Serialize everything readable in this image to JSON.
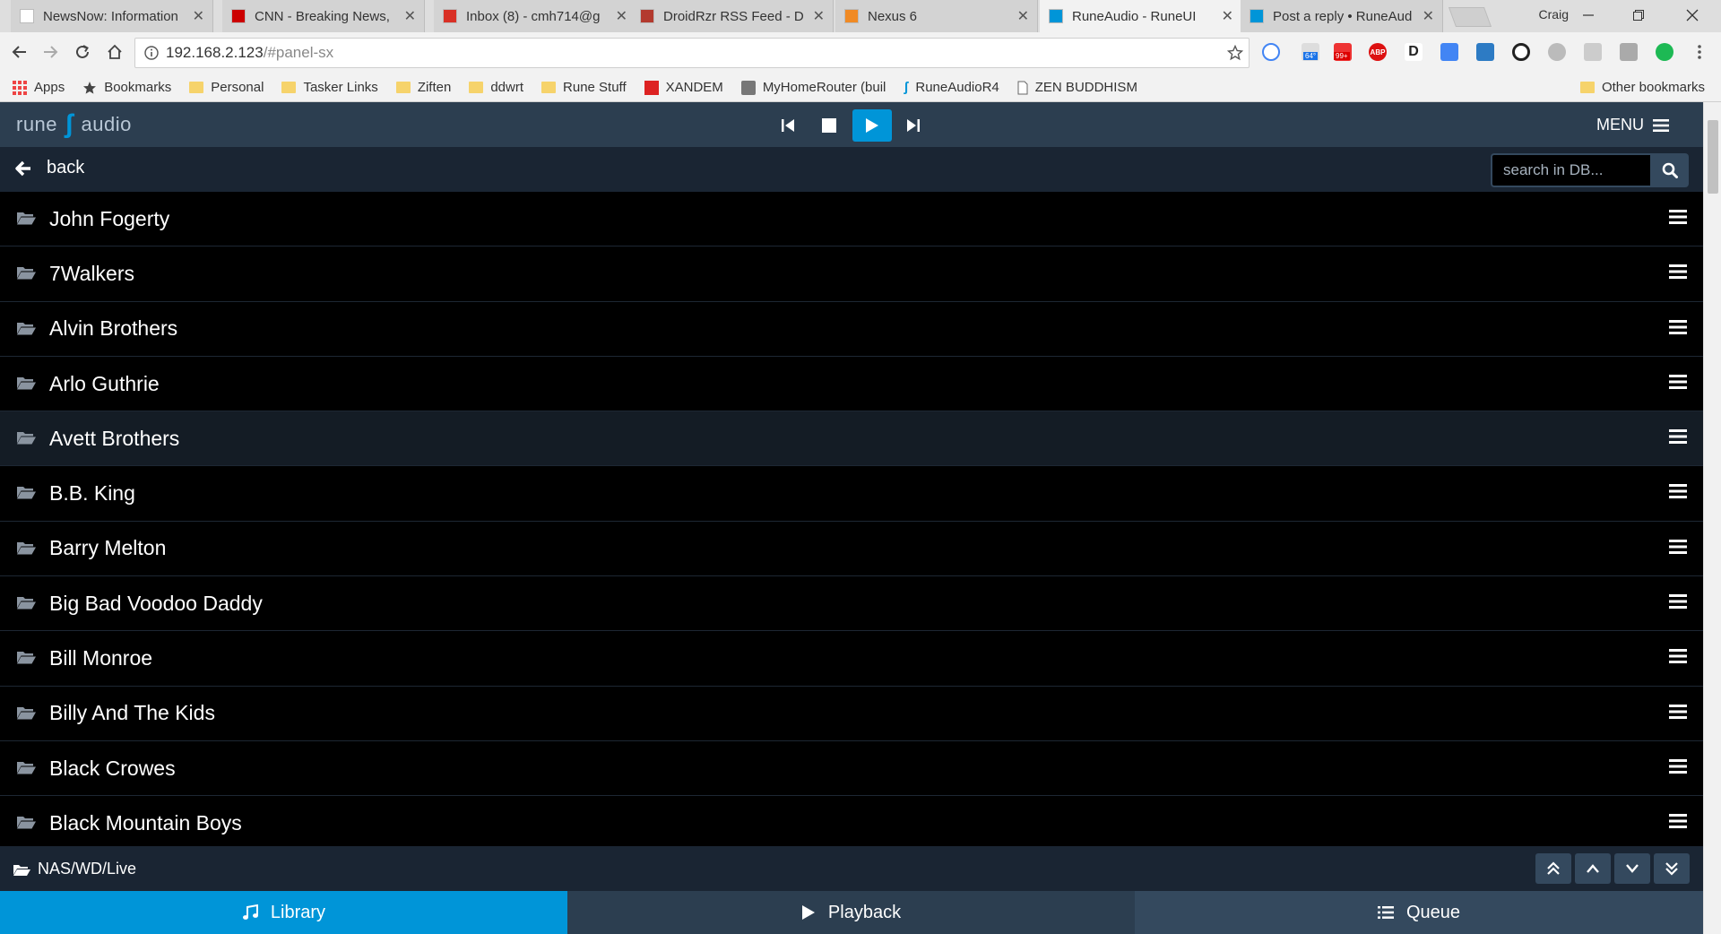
{
  "browser": {
    "tabs": [
      {
        "title": "NewsNow: Information",
        "favicon": "N",
        "color": "#ffffff"
      },
      {
        "title": "CNN - Breaking News,",
        "favicon": "CNN",
        "color": "#cc0000"
      },
      {
        "title": "Inbox (8) - cmh714@g",
        "favicon": "M",
        "color": "#d93025"
      },
      {
        "title": "DroidRzr RSS Feed - D",
        "favicon": "●",
        "color": "#b33a2e"
      },
      {
        "title": "Nexus 6",
        "favicon": "xda",
        "color": "#f08a24"
      },
      {
        "title": "RuneAudio - RuneUI",
        "favicon": "ʃ",
        "color": "#0095d8",
        "active": true
      },
      {
        "title": "Post a reply • RuneAud",
        "favicon": "ʃ",
        "color": "#0095d8"
      }
    ],
    "profile_name": "Craig",
    "url_host": "192.168.2.123",
    "url_path": "/#panel-sx",
    "bookmarks": [
      {
        "label": "Apps",
        "icon": "apps-grid-icon"
      },
      {
        "label": "Bookmarks",
        "icon": "star-icon"
      },
      {
        "label": "Personal",
        "icon": "folder-icon"
      },
      {
        "label": "Tasker Links",
        "icon": "folder-icon"
      },
      {
        "label": "Ziften",
        "icon": "folder-icon"
      },
      {
        "label": "ddwrt",
        "icon": "folder-icon"
      },
      {
        "label": "Rune Stuff",
        "icon": "folder-icon"
      },
      {
        "label": "XANDEM",
        "icon": "xandem-icon"
      },
      {
        "label": "MyHomeRouter (buil",
        "icon": "router-icon"
      },
      {
        "label": "RuneAudioR4",
        "icon": "rune-icon"
      },
      {
        "label": "ZEN BUDDHISM",
        "icon": "page-icon"
      }
    ],
    "other_bookmarks": "Other bookmarks",
    "badges": {
      "weather": "64°",
      "mail": "99+"
    }
  },
  "app": {
    "logo_left": "rune",
    "logo_right": "audio",
    "menu_label": "MENU",
    "back_label": "back",
    "search_placeholder": "search in DB...",
    "artists": [
      "John Fogerty",
      "7Walkers",
      "Alvin Brothers",
      "Arlo Guthrie",
      "Avett Brothers",
      "B.B. King",
      "Barry Melton",
      "Big Bad Voodoo Daddy",
      "Bill Monroe",
      "Billy And The Kids",
      "Black Crowes",
      "Black Mountain Boys"
    ],
    "hovered_index": 4,
    "current_path": "NAS/WD/Live",
    "bottom_tabs": [
      {
        "label": "Library",
        "icon": "music-note-icon",
        "active": true
      },
      {
        "label": "Playback",
        "icon": "play-icon",
        "active": false
      },
      {
        "label": "Queue",
        "icon": "list-icon",
        "active": false
      }
    ],
    "colors": {
      "accent": "#0095d8",
      "header": "#2c3e50",
      "subheader": "#1a2533",
      "button": "#34495e"
    }
  }
}
